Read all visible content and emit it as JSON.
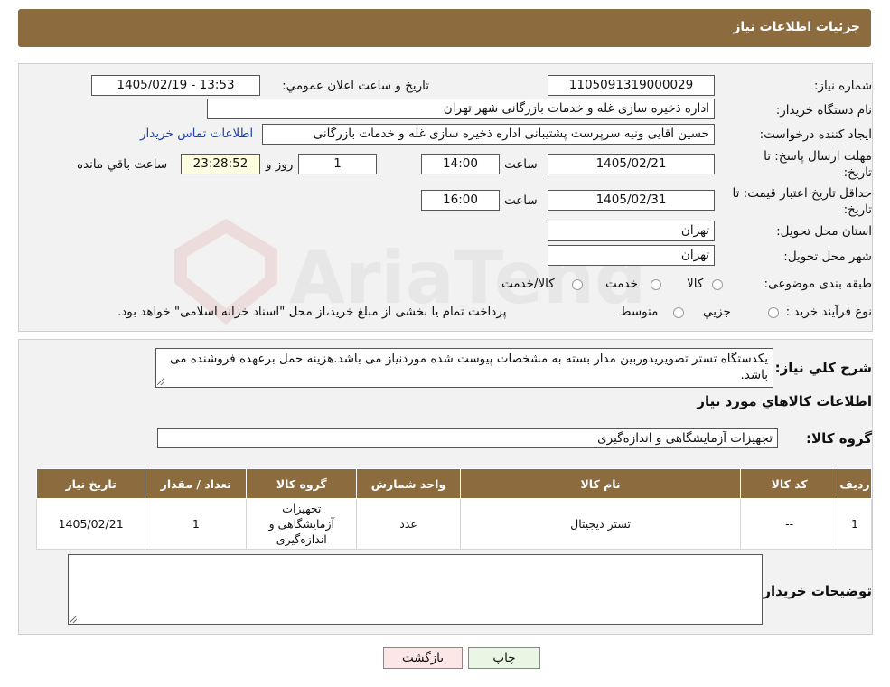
{
  "header": {
    "title": "جزئیات اطلاعات نیاز"
  },
  "details": {
    "need_number_label": "شماره نیاز:",
    "need_number": "1105091319000029",
    "announce_label": "تاريخ و ساعت اعلان عمومي:",
    "announce_value": "1405/02/19 - 13:53",
    "buyer_org_label": "نام دستگاه خريدار:",
    "buyer_org": "اداره ذخیره سازی غله و خدمات بازرگانی شهر تهران",
    "creator_label": "ايجاد کننده درخواست:",
    "creator": "حسین آقایی ونیه سرپرست پشتیبانی اداره ذخیره سازی غله و خدمات بازرگانی",
    "contact_link": "اطلاعات تماس خریدار",
    "deadline_label": "مهلت ارسال پاسخ: تا تاریخ:",
    "deadline_date": "1405/02/21",
    "time_label": "ساعت",
    "deadline_time": "14:00",
    "days": "1",
    "days_label": "روز و",
    "remaining": "23:28:52",
    "remaining_label": "ساعت باقي مانده",
    "validity_label": "حداقل تاريخ اعتبار قيمت: تا تاريخ:",
    "validity_date": "1405/02/31",
    "validity_time": "16:00",
    "province_label": "استان محل تحويل:",
    "province": "تهران",
    "city_label": "شهر محل تحويل:",
    "city": "تهران",
    "category_label": "طبقه بندی موضوعی:",
    "category_options": [
      "کالا",
      "خدمت",
      "کالا/خدمت"
    ],
    "process_label": "نوع فرآیند خرید :",
    "process_options": [
      "جزیي",
      "متوسط"
    ],
    "process_note": "پرداخت تمام یا بخشی از مبلغ خرید،از محل \"اسناد خزانه اسلامی\" خواهد بود."
  },
  "description": {
    "label": "شرح کلي نياز:",
    "text": "یکدستگاه تستر تصویریدوربین مدار بسته به مشخصات پیوست شده موردنیاز می باشد.هزینه حمل برعهده فروشنده می باشد."
  },
  "goods": {
    "section_title": "اطلاعات کالاهاي مورد نياز",
    "group_label": "گروه کالا:",
    "group_value": "تجهیزات آزمایشگاهی و اندازه‌گیری",
    "columns": [
      "رديف",
      "کد کالا",
      "نام کالا",
      "واحد شمارش",
      "گروه کالا",
      "تعداد / مقدار",
      "تاريخ نياز"
    ],
    "rows": [
      [
        "1",
        "--",
        "تستر دیجیتال",
        "عدد",
        "تجهیزات آزمایشگاهی و اندازه‌گیری",
        "1",
        "1405/02/21"
      ]
    ]
  },
  "notes": {
    "label": "توضيحات خريدار:",
    "value": ""
  },
  "buttons": {
    "print": "چاپ",
    "back": "بازگشت"
  },
  "watermark": {
    "text": "AriaTender.neT"
  },
  "colors": {
    "header_bg": "#8c6b3e",
    "link": "#1a3fb0",
    "back_button_bg": "#fde6e6",
    "print_button_bg": "#e8f6e3"
  }
}
